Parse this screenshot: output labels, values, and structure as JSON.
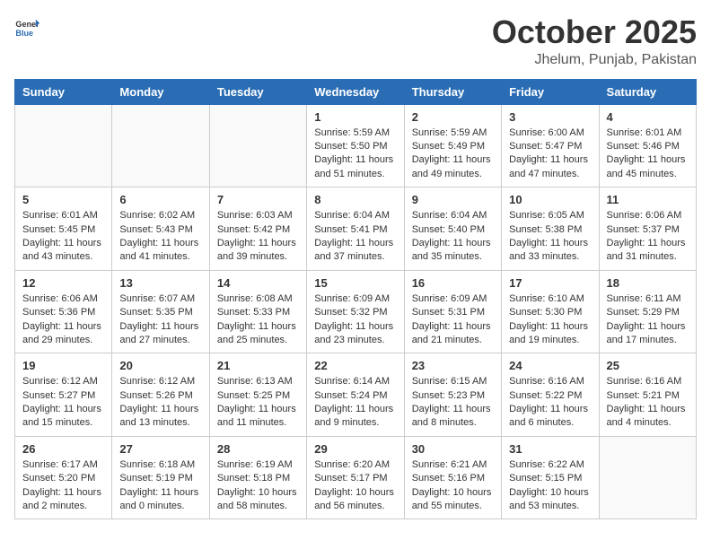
{
  "header": {
    "logo_general": "General",
    "logo_blue": "Blue",
    "month": "October 2025",
    "location": "Jhelum, Punjab, Pakistan"
  },
  "weekdays": [
    "Sunday",
    "Monday",
    "Tuesday",
    "Wednesday",
    "Thursday",
    "Friday",
    "Saturday"
  ],
  "weeks": [
    [
      {
        "day": "",
        "info": ""
      },
      {
        "day": "",
        "info": ""
      },
      {
        "day": "",
        "info": ""
      },
      {
        "day": "1",
        "info": "Sunrise: 5:59 AM\nSunset: 5:50 PM\nDaylight: 11 hours\nand 51 minutes."
      },
      {
        "day": "2",
        "info": "Sunrise: 5:59 AM\nSunset: 5:49 PM\nDaylight: 11 hours\nand 49 minutes."
      },
      {
        "day": "3",
        "info": "Sunrise: 6:00 AM\nSunset: 5:47 PM\nDaylight: 11 hours\nand 47 minutes."
      },
      {
        "day": "4",
        "info": "Sunrise: 6:01 AM\nSunset: 5:46 PM\nDaylight: 11 hours\nand 45 minutes."
      }
    ],
    [
      {
        "day": "5",
        "info": "Sunrise: 6:01 AM\nSunset: 5:45 PM\nDaylight: 11 hours\nand 43 minutes."
      },
      {
        "day": "6",
        "info": "Sunrise: 6:02 AM\nSunset: 5:43 PM\nDaylight: 11 hours\nand 41 minutes."
      },
      {
        "day": "7",
        "info": "Sunrise: 6:03 AM\nSunset: 5:42 PM\nDaylight: 11 hours\nand 39 minutes."
      },
      {
        "day": "8",
        "info": "Sunrise: 6:04 AM\nSunset: 5:41 PM\nDaylight: 11 hours\nand 37 minutes."
      },
      {
        "day": "9",
        "info": "Sunrise: 6:04 AM\nSunset: 5:40 PM\nDaylight: 11 hours\nand 35 minutes."
      },
      {
        "day": "10",
        "info": "Sunrise: 6:05 AM\nSunset: 5:38 PM\nDaylight: 11 hours\nand 33 minutes."
      },
      {
        "day": "11",
        "info": "Sunrise: 6:06 AM\nSunset: 5:37 PM\nDaylight: 11 hours\nand 31 minutes."
      }
    ],
    [
      {
        "day": "12",
        "info": "Sunrise: 6:06 AM\nSunset: 5:36 PM\nDaylight: 11 hours\nand 29 minutes."
      },
      {
        "day": "13",
        "info": "Sunrise: 6:07 AM\nSunset: 5:35 PM\nDaylight: 11 hours\nand 27 minutes."
      },
      {
        "day": "14",
        "info": "Sunrise: 6:08 AM\nSunset: 5:33 PM\nDaylight: 11 hours\nand 25 minutes."
      },
      {
        "day": "15",
        "info": "Sunrise: 6:09 AM\nSunset: 5:32 PM\nDaylight: 11 hours\nand 23 minutes."
      },
      {
        "day": "16",
        "info": "Sunrise: 6:09 AM\nSunset: 5:31 PM\nDaylight: 11 hours\nand 21 minutes."
      },
      {
        "day": "17",
        "info": "Sunrise: 6:10 AM\nSunset: 5:30 PM\nDaylight: 11 hours\nand 19 minutes."
      },
      {
        "day": "18",
        "info": "Sunrise: 6:11 AM\nSunset: 5:29 PM\nDaylight: 11 hours\nand 17 minutes."
      }
    ],
    [
      {
        "day": "19",
        "info": "Sunrise: 6:12 AM\nSunset: 5:27 PM\nDaylight: 11 hours\nand 15 minutes."
      },
      {
        "day": "20",
        "info": "Sunrise: 6:12 AM\nSunset: 5:26 PM\nDaylight: 11 hours\nand 13 minutes."
      },
      {
        "day": "21",
        "info": "Sunrise: 6:13 AM\nSunset: 5:25 PM\nDaylight: 11 hours\nand 11 minutes."
      },
      {
        "day": "22",
        "info": "Sunrise: 6:14 AM\nSunset: 5:24 PM\nDaylight: 11 hours\nand 9 minutes."
      },
      {
        "day": "23",
        "info": "Sunrise: 6:15 AM\nSunset: 5:23 PM\nDaylight: 11 hours\nand 8 minutes."
      },
      {
        "day": "24",
        "info": "Sunrise: 6:16 AM\nSunset: 5:22 PM\nDaylight: 11 hours\nand 6 minutes."
      },
      {
        "day": "25",
        "info": "Sunrise: 6:16 AM\nSunset: 5:21 PM\nDaylight: 11 hours\nand 4 minutes."
      }
    ],
    [
      {
        "day": "26",
        "info": "Sunrise: 6:17 AM\nSunset: 5:20 PM\nDaylight: 11 hours\nand 2 minutes."
      },
      {
        "day": "27",
        "info": "Sunrise: 6:18 AM\nSunset: 5:19 PM\nDaylight: 11 hours\nand 0 minutes."
      },
      {
        "day": "28",
        "info": "Sunrise: 6:19 AM\nSunset: 5:18 PM\nDaylight: 10 hours\nand 58 minutes."
      },
      {
        "day": "29",
        "info": "Sunrise: 6:20 AM\nSunset: 5:17 PM\nDaylight: 10 hours\nand 56 minutes."
      },
      {
        "day": "30",
        "info": "Sunrise: 6:21 AM\nSunset: 5:16 PM\nDaylight: 10 hours\nand 55 minutes."
      },
      {
        "day": "31",
        "info": "Sunrise: 6:22 AM\nSunset: 5:15 PM\nDaylight: 10 hours\nand 53 minutes."
      },
      {
        "day": "",
        "info": ""
      }
    ]
  ]
}
